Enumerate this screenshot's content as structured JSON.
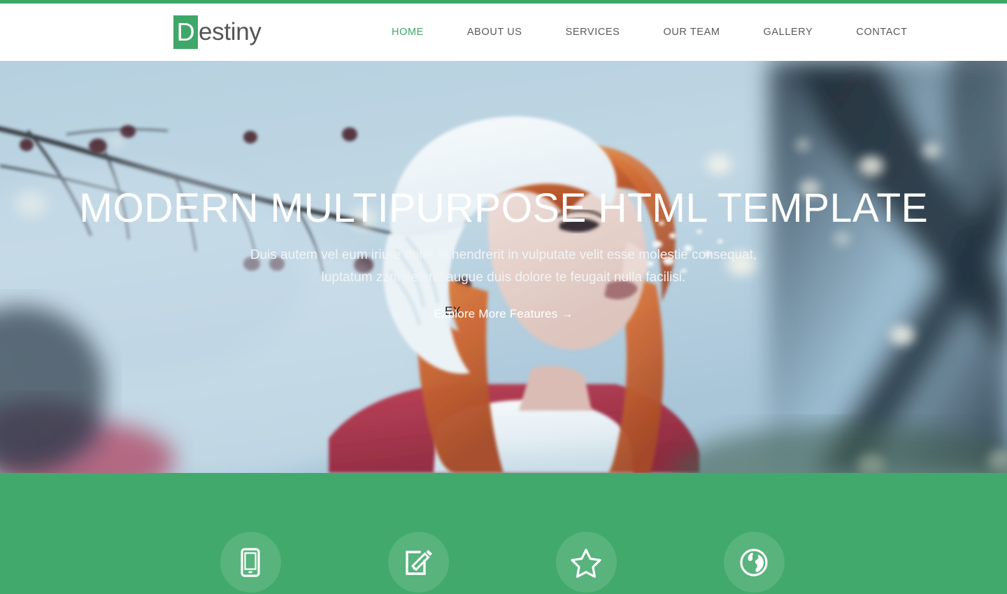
{
  "site": {
    "logo_badge": "D",
    "logo_text": "estiny"
  },
  "nav": {
    "items": [
      {
        "label": "HOME",
        "active": true
      },
      {
        "label": "ABOUT US",
        "active": false
      },
      {
        "label": "SERVICES",
        "active": false
      },
      {
        "label": "OUR TEAM",
        "active": false
      },
      {
        "label": "GALLERY",
        "active": false
      },
      {
        "label": "CONTACT",
        "active": false
      }
    ]
  },
  "hero": {
    "title": "MODERN MULTIPURPOSE HTML TEMPLATE",
    "subtitle": "Duis autem vel eum iriure dolor in hendrerit in vulputate velit esse molestie consequat, luptatum zzril delenit augue duis dolore te feugait nulla facilisi.",
    "cta_label": "Explore More Features →",
    "cta_overlap_text": "EX",
    "image_alt": "Woman in white fur hat blowing snow, winter bokeh background"
  },
  "services": {
    "items": [
      {
        "icon": "tablet-icon"
      },
      {
        "icon": "edit-pencil-square-icon"
      },
      {
        "icon": "star-icon"
      },
      {
        "icon": "globe-icon"
      }
    ]
  },
  "colors": {
    "brand_green": "#41a96b",
    "topbar_green": "#3aa765",
    "nav_text": "#5a5a5a",
    "logo_text": "#555555",
    "hero_text": "#ffffff"
  }
}
